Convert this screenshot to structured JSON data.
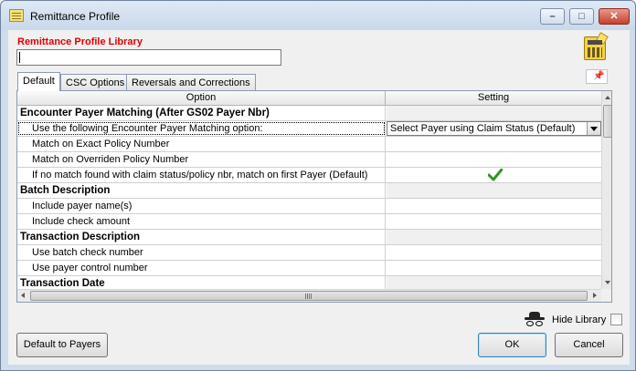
{
  "window": {
    "title": "Remittance Profile",
    "controls": {
      "minimize": "–",
      "maximize": "□",
      "close": "✕"
    }
  },
  "library": {
    "label": "Remittance Profile Library",
    "input_value": ""
  },
  "tabs": [
    {
      "label": "Default",
      "active": true
    },
    {
      "label": "CSC Options",
      "active": false
    },
    {
      "label": "Reversals and Corrections",
      "active": false
    }
  ],
  "grid": {
    "headers": {
      "option": "Option",
      "setting": "Setting"
    },
    "rows": [
      {
        "type": "group",
        "option": "Encounter Payer Matching (After GS02 Payer Nbr)"
      },
      {
        "type": "item",
        "option": "Use the following Encounter Payer Matching option:",
        "setting": "Select Payer using Claim Status (Default)",
        "setting_kind": "dropdown"
      },
      {
        "type": "item",
        "option": "Match on Exact Policy Number"
      },
      {
        "type": "item",
        "option": "Match on Overriden Policy Number"
      },
      {
        "type": "item",
        "option": "If no match found with claim status/policy nbr, match on first Payer (Default)",
        "setting_kind": "check"
      },
      {
        "type": "group",
        "option": "Batch Description"
      },
      {
        "type": "item",
        "option": "Include payer name(s)"
      },
      {
        "type": "item",
        "option": "Include check amount"
      },
      {
        "type": "group",
        "option": "Transaction Description"
      },
      {
        "type": "item",
        "option": "Use batch check number"
      },
      {
        "type": "item",
        "option": "Use payer control number"
      },
      {
        "type": "group",
        "option": "Transaction Date"
      }
    ]
  },
  "hide_library": {
    "label": "Hide Library",
    "checked": false
  },
  "buttons": {
    "default_to_payers": "Default to Payers",
    "ok": "OK",
    "cancel": "Cancel"
  },
  "icons": {
    "window": "notepad-icon",
    "library": "calculator-icon",
    "pin": "pin-icon",
    "hide_library": "spy-glasses-icon",
    "check": "green-checkmark-icon"
  },
  "colors": {
    "library_label": "#e00000",
    "checkmark": "#2a9a1a",
    "window_frame": "#cfdceb"
  }
}
